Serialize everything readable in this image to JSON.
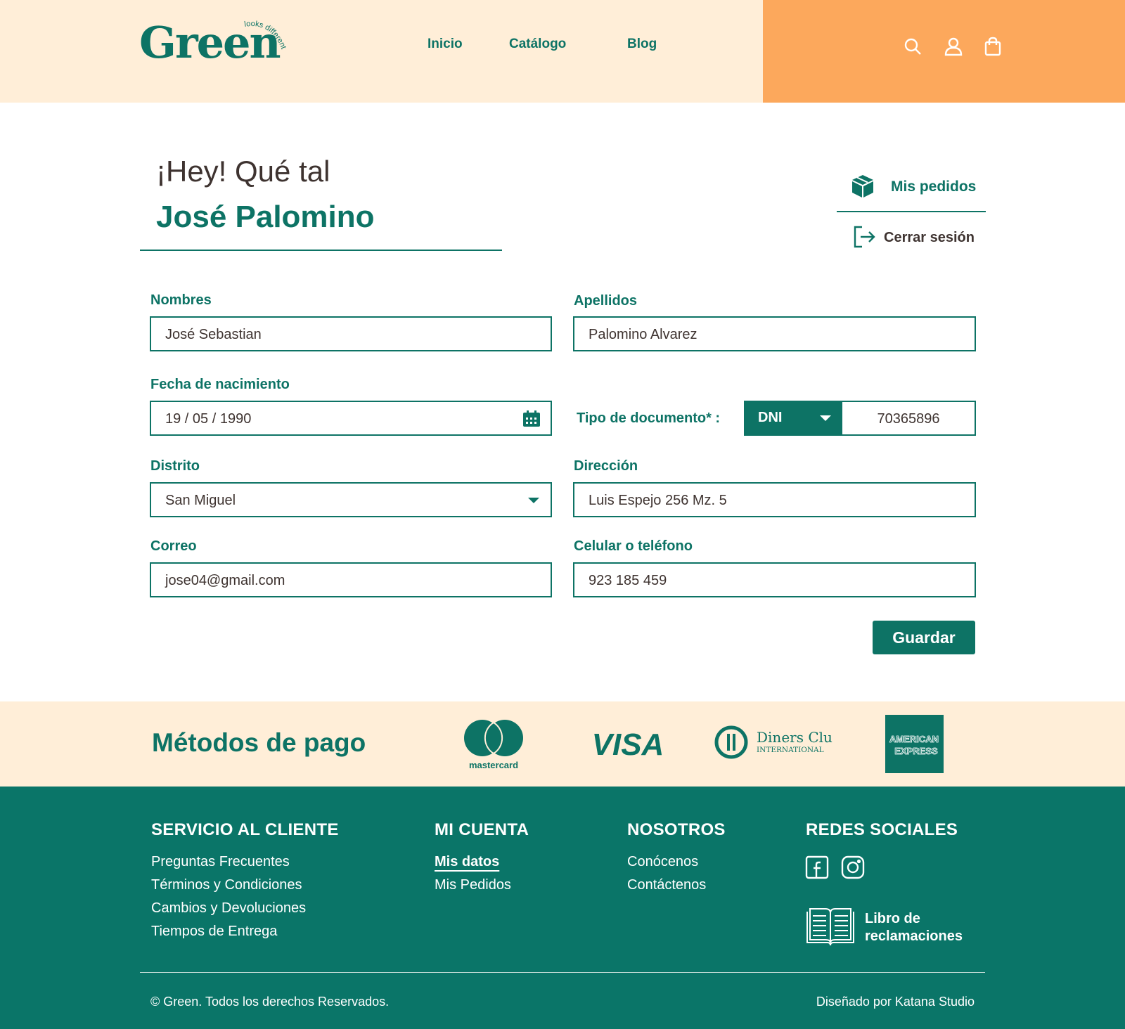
{
  "header": {
    "logo": "Green",
    "logo_tagline": "looks different",
    "nav": [
      "Inicio",
      "Catálogo",
      "Blog"
    ],
    "icons": [
      "search-icon",
      "user-icon",
      "bag-icon"
    ]
  },
  "profile": {
    "greeting": "¡Hey! Qué tal",
    "name": "José Palomino",
    "orders_label": "Mis pedidos",
    "logout_label": "Cerrar sesión"
  },
  "form": {
    "nombres": {
      "label": "Nombres",
      "value": "José Sebastian"
    },
    "apellidos": {
      "label": "Apellidos",
      "value": "Palomino Alvarez"
    },
    "fecha": {
      "label": "Fecha de nacimiento",
      "value": "19 / 05 / 1990"
    },
    "documento": {
      "label": "Tipo de documento* :",
      "type": "DNI",
      "number": "70365896"
    },
    "distrito": {
      "label": "Distrito",
      "value": "San Miguel"
    },
    "direccion": {
      "label": "Dirección",
      "value": "Luis Espejo 256 Mz. 5"
    },
    "correo": {
      "label": "Correo",
      "value": "jose04@gmail.com"
    },
    "celular": {
      "label": "Celular o teléfono",
      "value": "923 185 459"
    },
    "save_label": "Guardar"
  },
  "payment": {
    "title": "Métodos de pago",
    "methods": {
      "mastercard": "mastercard",
      "visa": "VISA",
      "diners_1": "Diners Club",
      "diners_2": "INTERNATIONAL",
      "amex_1": "AMERICAN",
      "amex_2": "EXPRESS"
    }
  },
  "footer": {
    "servicio": {
      "title": "SERVICIO AL CLIENTE",
      "links": [
        "Preguntas Frecuentes",
        "Términos y Condiciones",
        "Cambios y Devoluciones",
        "Tiempos de Entrega"
      ]
    },
    "cuenta": {
      "title": "MI CUENTA",
      "links": [
        "Mis datos",
        "Mis Pedidos"
      ]
    },
    "nosotros": {
      "title": "NOSOTROS",
      "links": [
        "Conócenos",
        "Contáctenos"
      ]
    },
    "redes": {
      "title": "REDES SOCIALES",
      "icons": [
        "facebook-icon",
        "instagram-icon"
      ],
      "book_line1": "Libro de",
      "book_line2": "reclamaciones"
    },
    "copyright": "© Green. Todos los derechos Reservados.",
    "credit": "Diseñado por Katana Studio"
  },
  "colors": {
    "brand_green": "#0d7365",
    "cream": "#ffeed8",
    "orange": "#fca85c"
  }
}
